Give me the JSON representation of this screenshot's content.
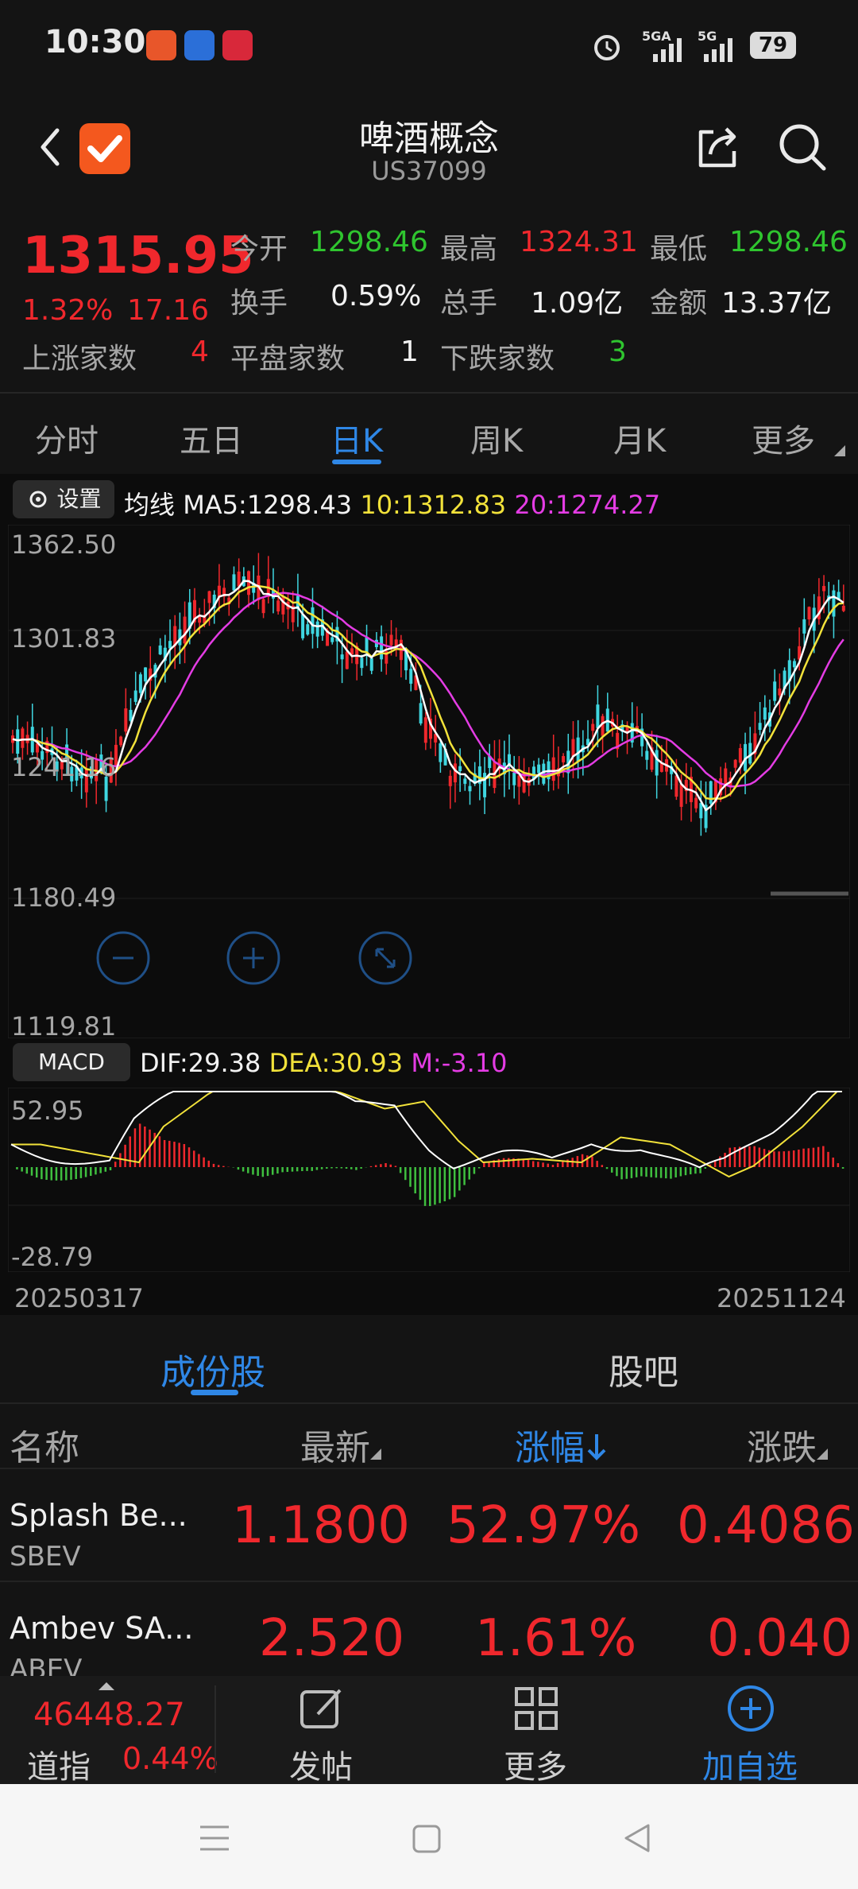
{
  "status": {
    "time": "10:30",
    "battery": "79",
    "signal1": "5GA",
    "signal2": "5G"
  },
  "header": {
    "title": "啤酒概念",
    "code": "US37099"
  },
  "quote": {
    "price": "1315.95",
    "change_pct": "1.32%",
    "change": "17.16",
    "open_label": "今开",
    "open": "1298.46",
    "high_label": "最高",
    "high": "1324.31",
    "low_label": "最低",
    "low": "1298.46",
    "turnover_label": "换手",
    "turnover": "0.59%",
    "volume_label": "总手",
    "volume": "1.09亿",
    "amount_label": "金额",
    "amount": "13.37亿",
    "up_label": "上涨家数",
    "up": "4",
    "flat_label": "平盘家数",
    "flat": "1",
    "down_label": "下跌家数",
    "down": "3"
  },
  "tabs": [
    "分时",
    "五日",
    "日K",
    "周K",
    "月K",
    "更多"
  ],
  "active_tab": "日K",
  "kline": {
    "settings_label": "设置",
    "ma_label": "均线",
    "ma5": "MA5:1298.43",
    "ma10": "10:1312.83",
    "ma20": "20:1274.27",
    "y_ticks": [
      "1362.50",
      "1301.83",
      "1241.16",
      "1180.49",
      "1119.81"
    ],
    "macd_label": "MACD",
    "dif": "DIF:29.38",
    "dea": "DEA:30.93",
    "m": "M:-3.10",
    "macd_ticks": [
      "52.95",
      "-28.79"
    ],
    "date_start": "20250317",
    "date_end": "20251124",
    "colors": {
      "up": "#f0282d",
      "down": "#3fd6e0",
      "ma5": "#ffffff",
      "ma10": "#f2e23a",
      "ma20": "#e43ce4"
    }
  },
  "components": {
    "tab_constituents": "成份股",
    "tab_forum": "股吧",
    "col_name": "名称",
    "col_latest": "最新",
    "col_change_pct": "涨幅",
    "col_change": "涨跌",
    "rows": [
      {
        "name": "Splash Be...",
        "code": "SBEV",
        "latest": "1.1800",
        "pct": "52.97%",
        "change": "0.4086"
      },
      {
        "name": "Ambev SA...",
        "code": "ABEV",
        "latest": "2.520",
        "pct": "1.61%",
        "change": "0.040"
      }
    ]
  },
  "toolbar": {
    "index_value": "46448.27",
    "index_name": "道指",
    "index_pct": "0.44%",
    "post_label": "发帖",
    "more_label": "更多",
    "watch_label": "加自选"
  }
}
